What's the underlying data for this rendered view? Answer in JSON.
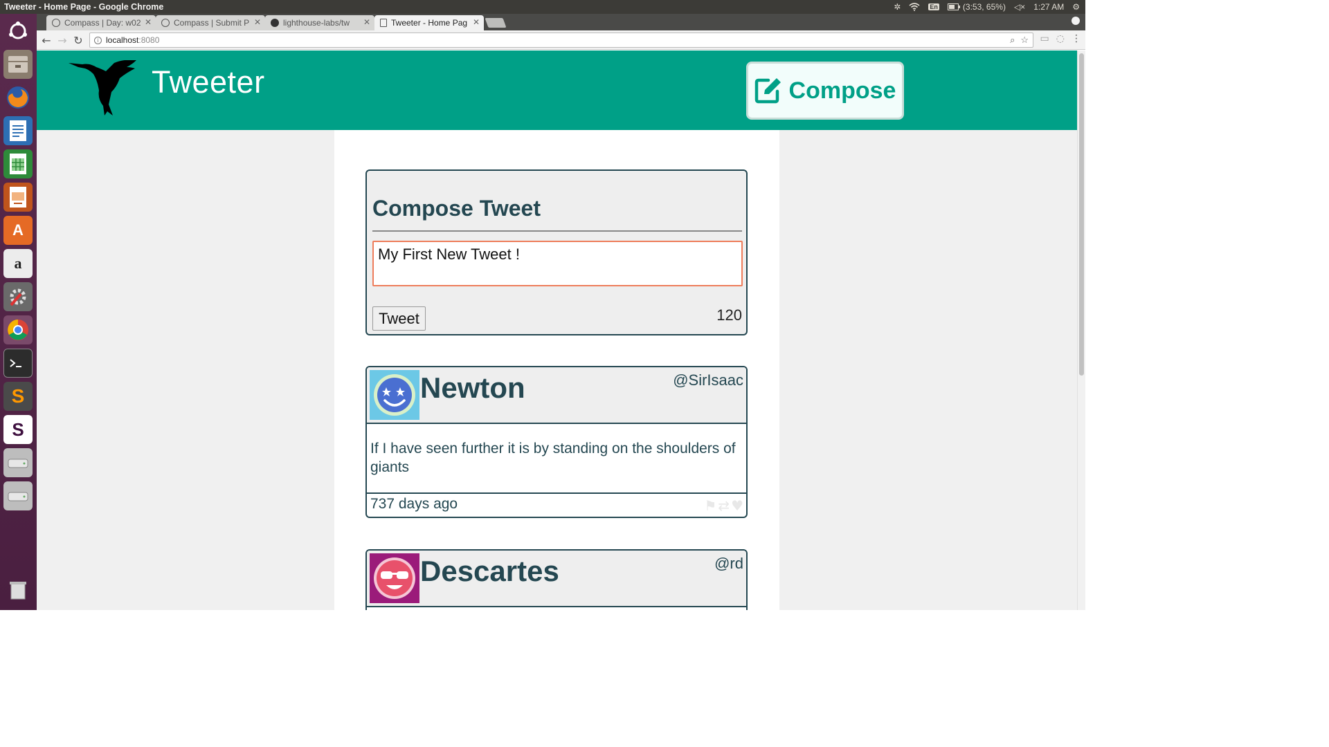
{
  "os": {
    "window_title": "Tweeter - Home Page - Google Chrome",
    "keyboard": "En",
    "battery": "(3:53, 65%)",
    "clock": "1:27 AM"
  },
  "browser": {
    "tabs": [
      {
        "label": "Compass | Day: w02",
        "active": false
      },
      {
        "label": "Compass | Submit P",
        "active": false
      },
      {
        "label": "lighthouse-labs/tw",
        "active": false
      },
      {
        "label": "Tweeter - Home Pag",
        "active": true
      }
    ],
    "url_host": "localhost",
    "url_port": ":8080"
  },
  "site": {
    "title": "Tweeter",
    "compose_label": "Compose",
    "brand_color": "#00a087"
  },
  "compose": {
    "heading": "Compose Tweet",
    "text_value": "My First New Tweet !",
    "submit_label": "Tweet",
    "counter": "120"
  },
  "tweets": [
    {
      "name": "Newton",
      "handle": "@SirIsaac",
      "content": "If I have seen further it is by standing on the shoulders of giants",
      "age": "737 days ago"
    },
    {
      "name": "Descartes",
      "handle": "@rd"
    }
  ]
}
